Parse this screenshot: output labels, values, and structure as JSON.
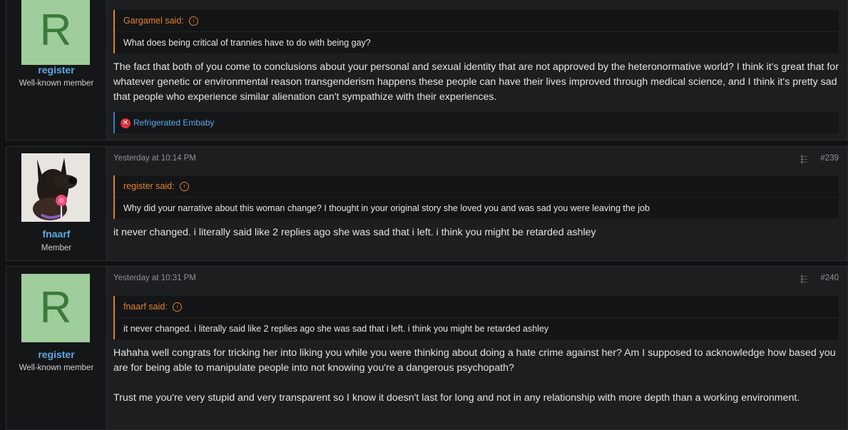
{
  "posts": [
    {
      "user": {
        "avatar_letter": "R",
        "name": "register",
        "title": "Well-known member"
      },
      "quote": {
        "author": "Gargamel said:",
        "text": "What does being critical of trannies have to do with being gay?"
      },
      "message": "The fact that both of you come to conclusions about your personal and sexual identity that are not approved by the heteronormative world? I think it's great that for whatever genetic or environmental reason transgenderism happens these people can have their lives improved through medical science, and I think it's pretty sad that people who experience similar alienation can't sympathize with their experiences.",
      "reaction": "Refrigerated Embaby"
    },
    {
      "user": {
        "name": "fnaarf",
        "title": "Member"
      },
      "date": "Yesterday at 10:14 PM",
      "number": "#239",
      "quote": {
        "author": "register said:",
        "text": "Why did your narrative about this woman change? I thought in your original story she loved you and was sad you were leaving the job"
      },
      "message": "it never changed. i literally said like 2 replies ago she was sad that i left. i think you might be retarded ashley"
    },
    {
      "user": {
        "avatar_letter": "R",
        "name": "register",
        "title": "Well-known member"
      },
      "date": "Yesterday at 10:31 PM",
      "number": "#240",
      "quote": {
        "author": "fnaarf said:",
        "text": "it never changed. i literally said like 2 replies ago she was sad that i left. i think you might be retarded ashley"
      },
      "message_p1": "Hahaha well congrats for tricking her into liking you while you were thinking about doing a hate crime against her? Am I supposed to acknowledge how based you are for being able to manipulate people into not knowing you're a dangerous psychopath?",
      "message_p2": "Trust me you're very stupid and very transparent so I know it doesn't last for long and not in any relationship with more depth than a working environment."
    }
  ],
  "icons": {
    "quote_arrow": "arrow-up-circle-icon",
    "share": "share-icon",
    "reaction": "x-circle-icon"
  },
  "colors": {
    "accent_orange": "#e0812a",
    "link_blue": "#5aa9e6",
    "avatar_green": "#9fcd9b"
  }
}
